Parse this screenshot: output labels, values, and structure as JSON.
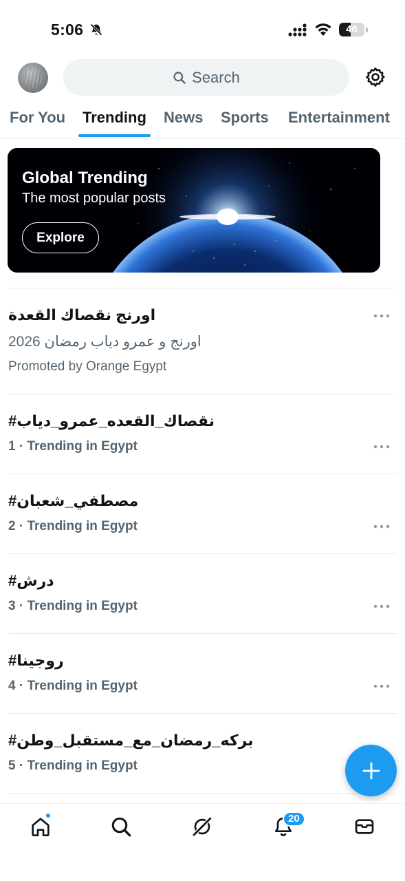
{
  "status_bar": {
    "time": "5:06",
    "battery_level": "46",
    "battery_fraction": 0.46,
    "icons": [
      "bell-slash-icon",
      "cellular-signal-icon",
      "wifi-icon",
      "battery-icon"
    ]
  },
  "header": {
    "search_placeholder": "Search",
    "icons": [
      "avatar",
      "search-icon",
      "gear-icon"
    ]
  },
  "tabs": [
    {
      "label": "For You",
      "active": false
    },
    {
      "label": "Trending",
      "active": true
    },
    {
      "label": "News",
      "active": false
    },
    {
      "label": "Sports",
      "active": false
    },
    {
      "label": "Entertainment",
      "active": false
    }
  ],
  "banner": {
    "title": "Global Trending",
    "subtitle": "The most popular posts",
    "button_label": "Explore"
  },
  "promoted": {
    "title": "اورنج نقصاك القعدة",
    "description": "اورنج و عمرو دياب رمضان 2026",
    "promoted_by": "Promoted by Orange Egypt"
  },
  "trends": [
    {
      "title": "#نقصاك_القعده_عمرو_دياب",
      "meta": "1 · Trending in Egypt"
    },
    {
      "title": "#مصطفي_شعبان",
      "meta": "2 · Trending in Egypt"
    },
    {
      "title": "#درش",
      "meta": "3 · Trending in Egypt"
    },
    {
      "title": "#روجينا",
      "meta": "4 · Trending in Egypt"
    },
    {
      "title": "#بركه_رمضان_مع_مستقبل_وطن",
      "meta": "5 · Trending in Egypt"
    }
  ],
  "bottom_nav": {
    "items": [
      "home-icon",
      "search-icon",
      "grok-icon",
      "bell-icon",
      "mail-icon"
    ],
    "notification_count": "20"
  },
  "colors": {
    "accent": "#1d9bf0",
    "text_primary": "#0f1419",
    "text_secondary": "#536471"
  }
}
